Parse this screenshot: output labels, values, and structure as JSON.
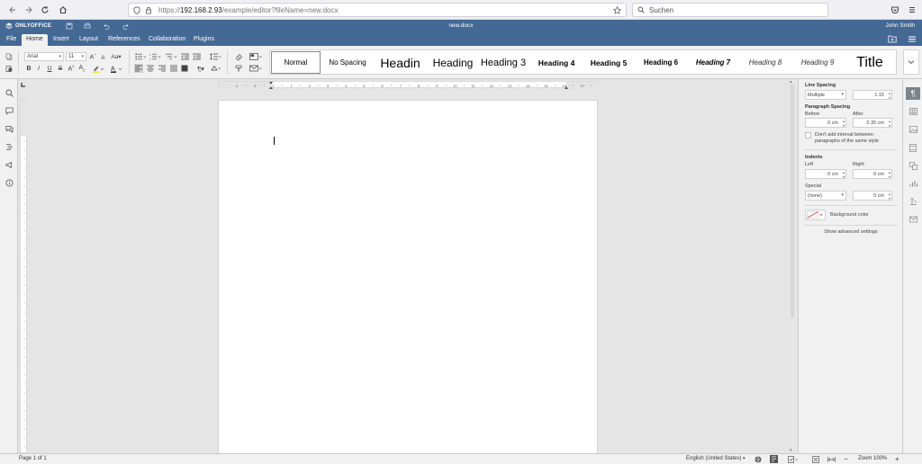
{
  "browser": {
    "url_host": "192.168.2.93",
    "url_path": "/example/editor?fileName=new.docx",
    "url_scheme": "https://",
    "search_placeholder": "Suchen",
    "nav_icons": [
      "back-icon",
      "forward-icon",
      "reload-icon",
      "home-icon"
    ]
  },
  "app": {
    "brand": "ONLYOFFICE",
    "doc_title": "new.docx",
    "user": "John Smith",
    "header_color": "#446995"
  },
  "menu": {
    "tabs": [
      "File",
      "Home",
      "Insert",
      "Layout",
      "References",
      "Collaboration",
      "Plugins"
    ],
    "active": "Home"
  },
  "toolbar": {
    "font_name": "Arial",
    "font_size": "11",
    "line_spacing_icon": "line-spacing-icon"
  },
  "styles": {
    "items": [
      {
        "label": "Normal"
      },
      {
        "label": "No Spacing"
      },
      {
        "label": "Headin"
      },
      {
        "label": "Heading"
      },
      {
        "label": "Heading 3"
      },
      {
        "label": "Heading 4"
      },
      {
        "label": "Heading 5"
      },
      {
        "label": "Heading 6"
      },
      {
        "label": "Heading 7"
      },
      {
        "label": "Heading 8"
      },
      {
        "label": "Heading 9"
      },
      {
        "label": "Title"
      }
    ],
    "selected": "Normal"
  },
  "ruler": {
    "h_numbers": [
      "1",
      "2",
      "1",
      "1",
      "2",
      "3",
      "4",
      "5",
      "6",
      "7",
      "8",
      "9",
      "10",
      "11",
      "12",
      "13",
      "14",
      "15",
      "16",
      "17"
    ]
  },
  "panel": {
    "line_spacing": {
      "title": "Line Spacing",
      "mode": "Multiple",
      "value": "1.15"
    },
    "paragraph_spacing": {
      "title": "Paragraph Spacing",
      "before_label": "Before",
      "after_label": "After",
      "before": "0 cm",
      "after": "0.35 cm"
    },
    "no_interval": "Don't add interval between paragraphs of the same style",
    "indents": {
      "title": "Indents",
      "left_label": "Left",
      "right_label": "Right",
      "left": "0 cm",
      "right": "0 cm",
      "special_label": "Special",
      "special": "(none)",
      "special_value": "0 cm"
    },
    "background_color": "Background color",
    "advanced": "Show advanced settings"
  },
  "status": {
    "page": "Page 1 of 1",
    "language": "English (United States)",
    "zoom": "Zoom 100%"
  }
}
